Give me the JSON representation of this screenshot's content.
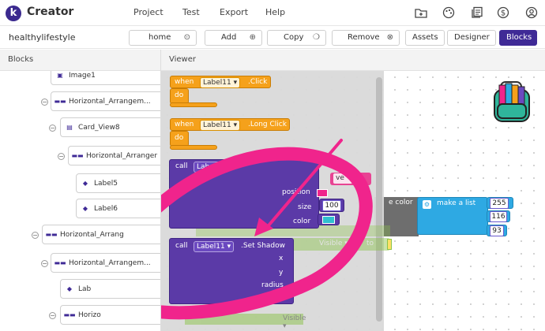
{
  "app": {
    "logo_letter": "k",
    "name": "Creator"
  },
  "menu": [
    {
      "label": "Project"
    },
    {
      "label": "Test"
    },
    {
      "label": "Export"
    },
    {
      "label": "Help"
    }
  ],
  "top_icons": [
    "folder-plus-icon",
    "palette-icon",
    "gallery-icon",
    "dollar-icon",
    "account-icon"
  ],
  "project_bar": {
    "project_name": "healthylifestyle",
    "screen_button": {
      "label": "home",
      "glyph": "⊙"
    },
    "add_button": {
      "label": "Add",
      "glyph": "⊕"
    },
    "copy_button": {
      "label": "Copy",
      "glyph": "❍"
    },
    "remove_button": {
      "label": "Remove",
      "glyph": "⊗"
    },
    "assets_tab": "Assets",
    "designer_tab": "Designer",
    "blocks_tab": "Blocks"
  },
  "panels": {
    "blocks_title": "Blocks",
    "viewer_title": "Viewer"
  },
  "tree": [
    {
      "label": "Image1"
    },
    {
      "label": "Horizontal_Arrangem..."
    },
    {
      "label": "Card_View8"
    },
    {
      "label": "Horizontal_Arranger"
    },
    {
      "label": "Label5"
    },
    {
      "label": "Label6"
    },
    {
      "label": "Horizontal_Arrang"
    },
    {
      "label": "Horizontal_Arrangem..."
    },
    {
      "label": "Lab"
    },
    {
      "label": "Horizo"
    }
  ],
  "blocks": {
    "event1": {
      "when": "when",
      "component": "Label11 ▾",
      "event": ".Click",
      "do": "do"
    },
    "event2": {
      "when": "when",
      "component": "Label11 ▾",
      "event": ".Long Click",
      "do": "do"
    },
    "call1": {
      "call": "call",
      "component": "Label11",
      "position": "position",
      "size": "size",
      "size_value": "100",
      "color": "color",
      "string_fragment": "ve \""
    },
    "call2": {
      "call": "call",
      "component": "Label11 ▾",
      "method": ".Set Shadow",
      "params": [
        "x",
        "y",
        "radius",
        "color"
      ]
    },
    "set_color": {
      "label": "e color",
      "make_list": "make a list",
      "values": [
        "255",
        "116",
        "93"
      ]
    },
    "ghost": {
      "visible": "Visible ▾",
      "to": "to"
    }
  },
  "colors": {
    "brand": "#3f2a96",
    "event_block": "#f5a11b",
    "component_block": "#5b3aa7",
    "list_block": "#2ea9e3",
    "annotation": "#f0248c"
  }
}
